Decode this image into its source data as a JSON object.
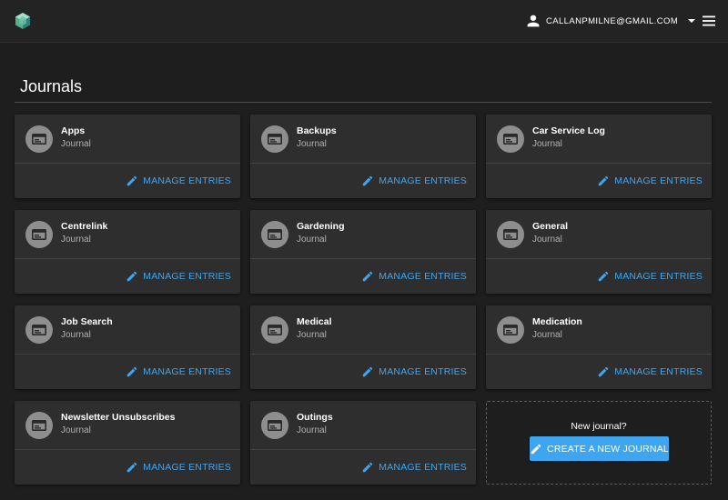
{
  "header": {
    "user_email": "CALLANPMILNE@GMAIL.COM",
    "icons": {
      "logo": "app-logo",
      "user": "account-icon",
      "caret": "caret-down-icon",
      "menu": "hamburger-menu-icon"
    }
  },
  "page": {
    "title": "Journals"
  },
  "journals": [
    {
      "name": "Apps",
      "type": "Journal",
      "action": "MANAGE ENTRIES"
    },
    {
      "name": "Backups",
      "type": "Journal",
      "action": "MANAGE ENTRIES"
    },
    {
      "name": "Car Service Log",
      "type": "Journal",
      "action": "MANAGE ENTRIES"
    },
    {
      "name": "Centrelink",
      "type": "Journal",
      "action": "MANAGE ENTRIES"
    },
    {
      "name": "Gardening",
      "type": "Journal",
      "action": "MANAGE ENTRIES"
    },
    {
      "name": "General",
      "type": "Journal",
      "action": "MANAGE ENTRIES"
    },
    {
      "name": "Job Search",
      "type": "Journal",
      "action": "MANAGE ENTRIES"
    },
    {
      "name": "Medical",
      "type": "Journal",
      "action": "MANAGE ENTRIES"
    },
    {
      "name": "Medication",
      "type": "Journal",
      "action": "MANAGE ENTRIES"
    },
    {
      "name": "Newsletter Unsubscribes",
      "type": "Journal",
      "action": "MANAGE ENTRIES"
    },
    {
      "name": "Outings",
      "type": "Journal",
      "action": "MANAGE ENTRIES"
    }
  ],
  "new_journal": {
    "prompt": "New journal?",
    "button_label": "CREATE A NEW JOURNAL"
  },
  "colors": {
    "background": "#1e1e1e",
    "card": "#2e2e2e",
    "accent": "#3ea6f0",
    "avatar": "#8e8e8e"
  }
}
